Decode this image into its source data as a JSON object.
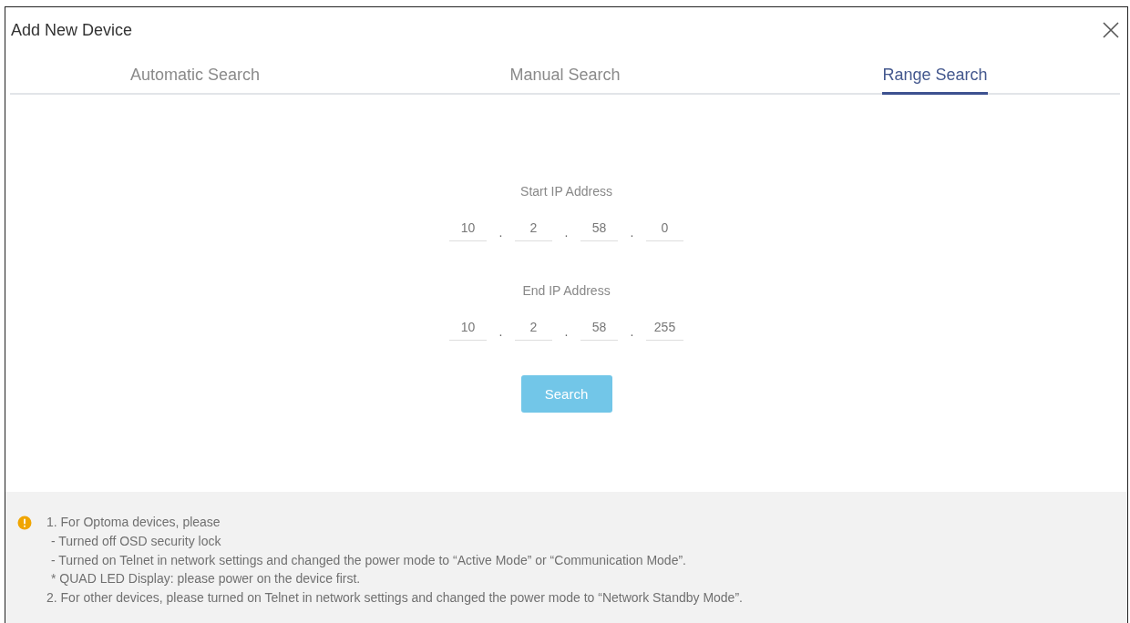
{
  "window": {
    "title": "Add New Device"
  },
  "tabs": [
    {
      "label": "Automatic Search",
      "selected": false
    },
    {
      "label": "Manual Search",
      "selected": false
    },
    {
      "label": "Range Search",
      "selected": true
    }
  ],
  "range": [
    {
      "label": "Start IP Address",
      "octets": [
        "10",
        "2",
        "58",
        "0"
      ],
      "separator": "."
    },
    {
      "label": "End IP Address",
      "octets": [
        "10",
        "2",
        "58",
        "255"
      ],
      "separator": "."
    }
  ],
  "search_button": "Search",
  "notes": [
    {
      "text": "1. For Optoma devices, please",
      "children": [
        "- Turned off OSD security lock",
        "- Turned on Telnet in network settings and changed the power mode to “Active Mode” or “Communication Mode”.",
        "* QUAD LED Display: please power on the device first."
      ]
    },
    {
      "text": "2. For other devices, please turned on Telnet in network settings and changed the power mode to “Network Standby Mode”."
    }
  ]
}
